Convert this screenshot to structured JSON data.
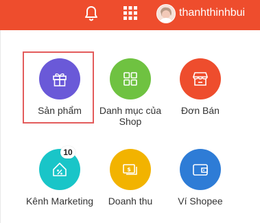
{
  "header": {
    "username": "thanhthinhbui",
    "icons": [
      "bell-icon",
      "apps-grid-icon",
      "avatar"
    ],
    "colors": {
      "bar": "#ee4d2d"
    }
  },
  "menu": {
    "selected": "Sản phẩm",
    "items": [
      {
        "label": "Sản phẩm",
        "icon": "gift-icon",
        "color": "#6a59d8"
      },
      {
        "label": "Danh mục của Shop",
        "icon": "category-grid-icon",
        "color": "#6fc241"
      },
      {
        "label": "Đơn Bán",
        "icon": "store-icon",
        "color": "#ee4d2d"
      },
      {
        "label": "Kênh Marketing",
        "icon": "discount-tag-icon",
        "color": "#19c5c8",
        "badge": "10"
      },
      {
        "label": "Doanh thu",
        "icon": "money-icon",
        "color": "#f2b300"
      },
      {
        "label": "Ví Shopee",
        "icon": "wallet-icon",
        "color": "#2e7cd6"
      }
    ]
  }
}
